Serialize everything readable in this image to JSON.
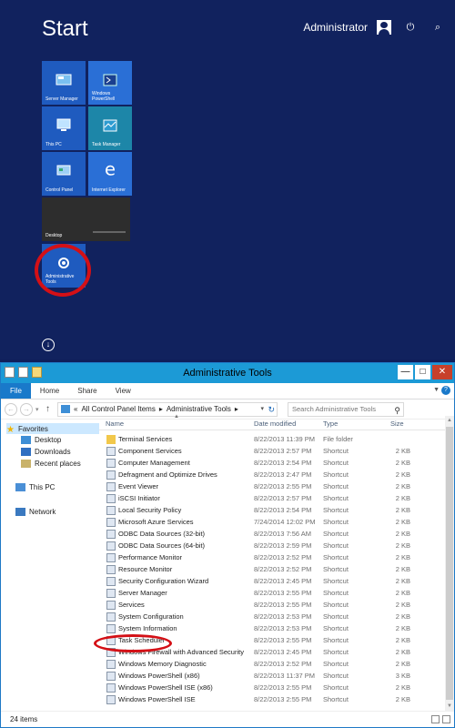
{
  "start": {
    "title": "Start",
    "user": "Administrator",
    "power_glyph": "⏻",
    "search_glyph": "⌕",
    "down_glyph": "↓",
    "tiles": [
      {
        "label": "Server Manager",
        "icon": "server-manager-icon"
      },
      {
        "label": "Windows PowerShell",
        "icon": "powershell-icon"
      },
      {
        "label": "This PC",
        "icon": "computer-icon"
      },
      {
        "label": "Task Manager",
        "icon": "task-manager-icon"
      },
      {
        "label": "Control Panel",
        "icon": "control-panel-icon"
      },
      {
        "label": "Internet Explorer",
        "icon": "internet-explorer-icon"
      },
      {
        "label": "Desktop",
        "icon": "desktop-icon"
      },
      {
        "label": "Administrative Tools",
        "icon": "administrative-tools-icon"
      }
    ]
  },
  "window": {
    "title": "Administrative Tools",
    "controls": {
      "minimize": "—",
      "maximize": "□",
      "close": "✕"
    },
    "ribbon_tabs": [
      "File",
      "Home",
      "Share",
      "View"
    ],
    "help": "?",
    "address": {
      "prefix": "«",
      "crumb1": "All Control Panel Items",
      "sep": "▸",
      "crumb2": "Administrative Tools",
      "dropdown": "▾",
      "refresh": "↻"
    },
    "search_placeholder": "Search Administrative Tools",
    "nav": {
      "favorites": "Favorites",
      "desktop": "Desktop",
      "downloads": "Downloads",
      "recent": "Recent places",
      "this_pc": "This PC",
      "network": "Network"
    },
    "columns": {
      "name": "Name",
      "date": "Date modified",
      "type": "Type",
      "size": "Size"
    },
    "files": [
      {
        "name": "Terminal Services",
        "date": "8/22/2013 11:39 PM",
        "type": "File folder",
        "size": "",
        "kind": "folder"
      },
      {
        "name": "Component Services",
        "date": "8/22/2013 2:57 PM",
        "type": "Shortcut",
        "size": "2 KB",
        "kind": "shortcut"
      },
      {
        "name": "Computer Management",
        "date": "8/22/2013 2:54 PM",
        "type": "Shortcut",
        "size": "2 KB",
        "kind": "shortcut"
      },
      {
        "name": "Defragment and Optimize Drives",
        "date": "8/22/2013 2:47 PM",
        "type": "Shortcut",
        "size": "2 KB",
        "kind": "shortcut"
      },
      {
        "name": "Event Viewer",
        "date": "8/22/2013 2:55 PM",
        "type": "Shortcut",
        "size": "2 KB",
        "kind": "shortcut"
      },
      {
        "name": "iSCSI Initiator",
        "date": "8/22/2013 2:57 PM",
        "type": "Shortcut",
        "size": "2 KB",
        "kind": "shortcut"
      },
      {
        "name": "Local Security Policy",
        "date": "8/22/2013 2:54 PM",
        "type": "Shortcut",
        "size": "2 KB",
        "kind": "shortcut"
      },
      {
        "name": "Microsoft Azure Services",
        "date": "7/24/2014 12:02 PM",
        "type": "Shortcut",
        "size": "2 KB",
        "kind": "shortcut"
      },
      {
        "name": "ODBC Data Sources (32-bit)",
        "date": "8/22/2013 7:56 AM",
        "type": "Shortcut",
        "size": "2 KB",
        "kind": "shortcut"
      },
      {
        "name": "ODBC Data Sources (64-bit)",
        "date": "8/22/2013 2:59 PM",
        "type": "Shortcut",
        "size": "2 KB",
        "kind": "shortcut"
      },
      {
        "name": "Performance Monitor",
        "date": "8/22/2013 2:52 PM",
        "type": "Shortcut",
        "size": "2 KB",
        "kind": "shortcut"
      },
      {
        "name": "Resource Monitor",
        "date": "8/22/2013 2:52 PM",
        "type": "Shortcut",
        "size": "2 KB",
        "kind": "shortcut"
      },
      {
        "name": "Security Configuration Wizard",
        "date": "8/22/2013 2:45 PM",
        "type": "Shortcut",
        "size": "2 KB",
        "kind": "shortcut"
      },
      {
        "name": "Server Manager",
        "date": "8/22/2013 2:55 PM",
        "type": "Shortcut",
        "size": "2 KB",
        "kind": "shortcut"
      },
      {
        "name": "Services",
        "date": "8/22/2013 2:55 PM",
        "type": "Shortcut",
        "size": "2 KB",
        "kind": "shortcut"
      },
      {
        "name": "System Configuration",
        "date": "8/22/2013 2:53 PM",
        "type": "Shortcut",
        "size": "2 KB",
        "kind": "shortcut"
      },
      {
        "name": "System Information",
        "date": "8/22/2013 2:53 PM",
        "type": "Shortcut",
        "size": "2 KB",
        "kind": "shortcut"
      },
      {
        "name": "Task Scheduler",
        "date": "8/22/2013 2:55 PM",
        "type": "Shortcut",
        "size": "2 KB",
        "kind": "shortcut"
      },
      {
        "name": "Windows Firewall with Advanced Security",
        "date": "8/22/2013 2:45 PM",
        "type": "Shortcut",
        "size": "2 KB",
        "kind": "shortcut"
      },
      {
        "name": "Windows Memory Diagnostic",
        "date": "8/22/2013 2:52 PM",
        "type": "Shortcut",
        "size": "2 KB",
        "kind": "shortcut"
      },
      {
        "name": "Windows PowerShell (x86)",
        "date": "8/22/2013 11:37 PM",
        "type": "Shortcut",
        "size": "3 KB",
        "kind": "shortcut"
      },
      {
        "name": "Windows PowerShell ISE (x86)",
        "date": "8/22/2013 2:55 PM",
        "type": "Shortcut",
        "size": "2 KB",
        "kind": "shortcut"
      },
      {
        "name": "Windows PowerShell ISE",
        "date": "8/22/2013 2:55 PM",
        "type": "Shortcut",
        "size": "2 KB",
        "kind": "shortcut"
      }
    ],
    "status": "24 items"
  },
  "colors": {
    "start_bg": "#11225e",
    "tile_blue": "#1f5bbf",
    "highlight_red": "#d41016",
    "title_bar": "#1c9ad6"
  }
}
